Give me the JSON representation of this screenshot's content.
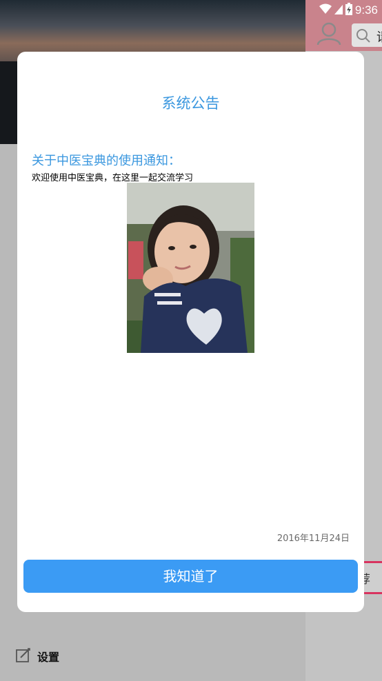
{
  "status_bar": {
    "time": "9:36",
    "icons": [
      "wifi-icon",
      "signal-icon",
      "battery-charging-icon"
    ]
  },
  "background": {
    "search_partial_text": "请",
    "recommend_partial_text": "荐",
    "settings_label": "设置",
    "colors": {
      "topbar": "#c9838c",
      "recommend_accent": "#d8345f"
    }
  },
  "dialog": {
    "title": "系统公告",
    "notice_title": "关于中医宝典的使用通知：",
    "notice_body": "欢迎使用中医宝典，在这里一起交流学习",
    "date": "2016年11月24日",
    "confirm_button": "我知道了",
    "colors": {
      "accent": "#3a97df",
      "button": "#3b9bf4"
    }
  }
}
